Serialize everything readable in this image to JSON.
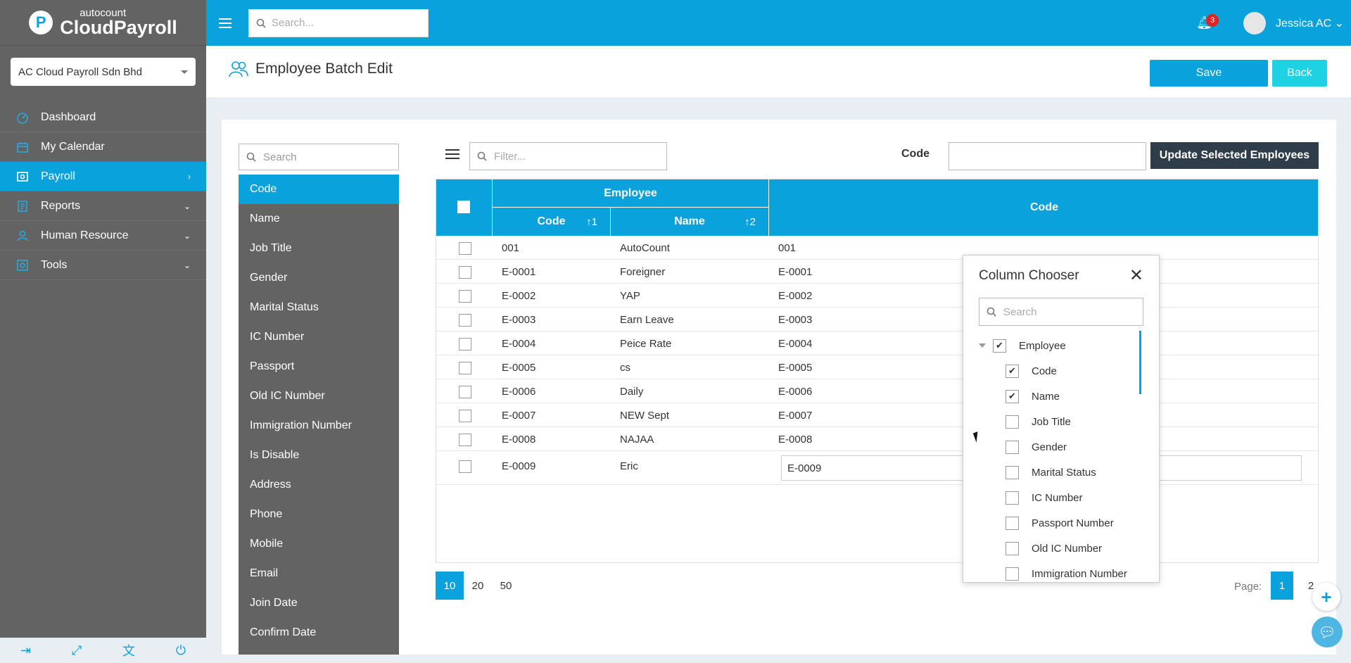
{
  "brand": {
    "small": "autocount",
    "big": "CloudPayroll",
    "badge": "P"
  },
  "company": {
    "name": "AC Cloud Payroll Sdn Bhd"
  },
  "nav": [
    {
      "label": "Dashboard",
      "icon": "dashboard-icon",
      "active": false,
      "arrow": ""
    },
    {
      "label": "My Calendar",
      "icon": "calendar-icon",
      "active": false,
      "arrow": ""
    },
    {
      "label": "Payroll",
      "icon": "payroll-icon",
      "active": true,
      "arrow": "›"
    },
    {
      "label": "Reports",
      "icon": "reports-icon",
      "active": false,
      "arrow": "⌄"
    },
    {
      "label": "Human Resource",
      "icon": "hr-icon",
      "active": false,
      "arrow": "⌄"
    },
    {
      "label": "Tools",
      "icon": "tools-icon",
      "active": false,
      "arrow": "⌄"
    }
  ],
  "topbar": {
    "search_placeholder": "Search...",
    "notifications": "3",
    "user": "Jessica AC"
  },
  "page": {
    "title": "Employee Batch Edit",
    "save": "Save",
    "back": "Back"
  },
  "fields": {
    "search_placeholder": "Search",
    "items": [
      "Code",
      "Name",
      "Job Title",
      "Gender",
      "Marital Status",
      "IC Number",
      "Passport",
      "Old IC Number",
      "Immigration Number",
      "Is Disable",
      "Address",
      "Phone",
      "Mobile",
      "Email",
      "Join Date",
      "Confirm Date"
    ]
  },
  "toolbar": {
    "filter_placeholder": "Filter...",
    "code_label": "Code",
    "update_button": "Update Selected Employees"
  },
  "table": {
    "group_header": "Employee",
    "col_code": "Code",
    "col_code_sort": "↑1",
    "col_name": "Name",
    "col_name_sort": "↑2",
    "col_edit": "Code",
    "rows": [
      {
        "code": "001",
        "name": "AutoCount",
        "value": "001"
      },
      {
        "code": "E-0001",
        "name": "Foreigner",
        "value": "E-0001"
      },
      {
        "code": "E-0002",
        "name": "YAP",
        "value": "E-0002"
      },
      {
        "code": "E-0003",
        "name": "Earn Leave",
        "value": "E-0003"
      },
      {
        "code": "E-0004",
        "name": "Peice Rate",
        "value": "E-0004"
      },
      {
        "code": "E-0005",
        "name": "cs",
        "value": "E-0005"
      },
      {
        "code": "E-0006",
        "name": "Daily",
        "value": "E-0006"
      },
      {
        "code": "E-0007",
        "name": "NEW Sept",
        "value": "E-0007"
      },
      {
        "code": "E-0008",
        "name": "NAJAA",
        "value": "E-0008"
      },
      {
        "code": "E-0009",
        "name": "Eric",
        "value": "E-0009"
      }
    ]
  },
  "pager": {
    "sizes": [
      "10",
      "20",
      "50"
    ],
    "page_label": "Page:",
    "pages": [
      "1",
      "2"
    ]
  },
  "column_chooser": {
    "title": "Column Chooser",
    "search_placeholder": "Search",
    "items": [
      {
        "label": "Employee",
        "checked": true,
        "level": 0
      },
      {
        "label": "Code",
        "checked": true,
        "level": 1
      },
      {
        "label": "Name",
        "checked": true,
        "level": 1
      },
      {
        "label": "Job Title",
        "checked": false,
        "level": 1
      },
      {
        "label": "Gender",
        "checked": false,
        "level": 1
      },
      {
        "label": "Marital Status",
        "checked": false,
        "level": 1
      },
      {
        "label": "IC Number",
        "checked": false,
        "level": 1
      },
      {
        "label": "Passport Number",
        "checked": false,
        "level": 1
      },
      {
        "label": "Old IC Number",
        "checked": false,
        "level": 1
      },
      {
        "label": "Immigration Number",
        "checked": false,
        "level": 1
      }
    ]
  },
  "colors": {
    "accent": "#0aa2dd",
    "sidebar": "#636363",
    "dark_button": "#2f3d4a"
  }
}
